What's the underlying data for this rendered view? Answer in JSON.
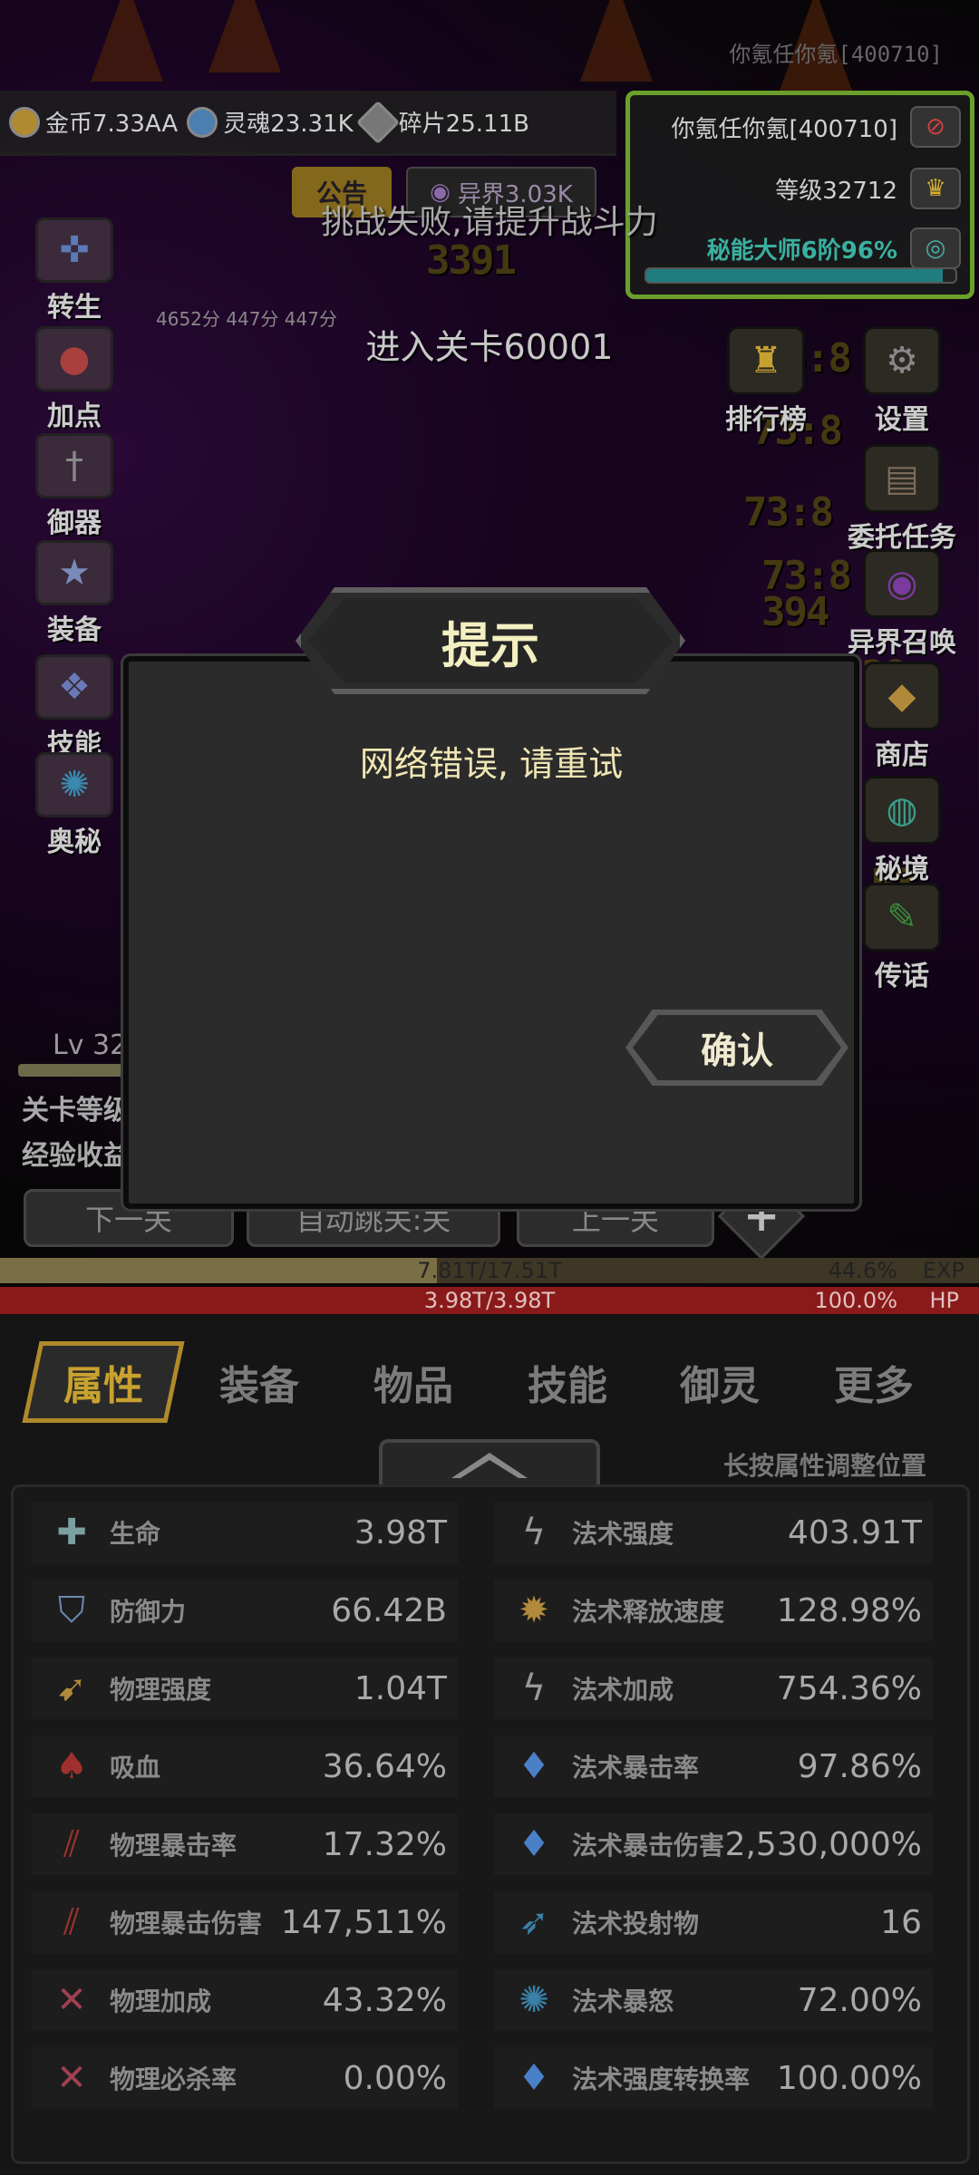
{
  "player_id_faint": "你氪任你氪[400710]",
  "currency": {
    "coin": "金币7.33AA",
    "soul": "灵魂23.31K",
    "shard": "碎片25.11B"
  },
  "player": {
    "name": "你氪任你氪[400710]",
    "level": "等级32712",
    "rank": "秘能大师6阶96%",
    "rank_progress": 0.96
  },
  "chips": {
    "notice": "公告",
    "realm": "异界3.03K"
  },
  "toasts": {
    "fail": "挑战失败,请提升战斗力",
    "enter": "进入关卡60001"
  },
  "scores": "4652分  447分  447分",
  "left_menu": [
    {
      "label": "转生",
      "icon": "rebirth-icon"
    },
    {
      "label": "加点",
      "icon": "meat-icon"
    },
    {
      "label": "御器",
      "icon": "sword-icon"
    },
    {
      "label": "装备",
      "icon": "star-shield-icon"
    },
    {
      "label": "技能",
      "icon": "scroll-icon"
    },
    {
      "label": "奥秘",
      "icon": "vortex-icon"
    }
  ],
  "right_menu": [
    {
      "label": "排行榜",
      "icon": "trophy-icon"
    },
    {
      "label": "设置",
      "icon": "gear-icon"
    },
    {
      "label": "委托任务",
      "icon": "book-icon"
    },
    {
      "label": "异界召唤",
      "icon": "portal-icon"
    },
    {
      "label": "商店",
      "icon": "shop-icon"
    },
    {
      "label": "秘境",
      "icon": "secret-realm-icon"
    },
    {
      "label": "传话",
      "icon": "message-icon"
    }
  ],
  "stage": {
    "level_label": "Lv 32",
    "info1": "关卡等级",
    "info2": "经验收益"
  },
  "nav": {
    "next": "下一关",
    "auto": "自动跳关:关",
    "prev": "上一关"
  },
  "bars": {
    "exp_value": "7.81T/17.51T",
    "exp_percent": "44.6%",
    "exp_label": "EXP",
    "exp_fraction": 0.446,
    "hp_value": "3.98T/3.98T",
    "hp_percent": "100.0%",
    "hp_label": "HP"
  },
  "modal": {
    "title": "提示",
    "message": "网络错误, 请重试",
    "confirm": "确认"
  },
  "tabs": [
    "属性",
    "装备",
    "物品",
    "技能",
    "御灵",
    "更多"
  ],
  "active_tab": "属性",
  "hint": "长按属性调整位置",
  "attributes_left": [
    {
      "name": "生命",
      "value": "3.98T",
      "icon": "health-cross-icon"
    },
    {
      "name": "防御力",
      "value": "66.42B",
      "icon": "shield-icon"
    },
    {
      "name": "物理强度",
      "value": "1.04T",
      "icon": "feather-blade-icon"
    },
    {
      "name": "吸血",
      "value": "36.64%",
      "icon": "bat-icon"
    },
    {
      "name": "物理暴击率",
      "value": "17.32%",
      "icon": "claw-icon"
    },
    {
      "name": "物理暴击伤害",
      "value": "147,511%",
      "icon": "claw-icon"
    },
    {
      "name": "物理加成",
      "value": "43.32%",
      "icon": "slash-icon"
    },
    {
      "name": "物理必杀率",
      "value": "0.00%",
      "icon": "slash-icon"
    }
  ],
  "attributes_right": [
    {
      "name": "法术强度",
      "value": "403.91T",
      "icon": "lightning-icon"
    },
    {
      "name": "法术释放速度",
      "value": "128.98%",
      "icon": "spark-icon"
    },
    {
      "name": "法术加成",
      "value": "754.36%",
      "icon": "lightning-icon"
    },
    {
      "name": "法术暴击率",
      "value": "97.86%",
      "icon": "blue-flame-icon"
    },
    {
      "name": "法术暴击伤害",
      "value": "2,530,000%",
      "icon": "blue-flame-icon"
    },
    {
      "name": "法术投射物",
      "value": "16",
      "icon": "projectile-icon"
    },
    {
      "name": "法术暴怒",
      "value": "72.00%",
      "icon": "rage-icon"
    },
    {
      "name": "法术强度转换率",
      "value": "100.00%",
      "icon": "blue-flame-icon"
    }
  ],
  "colors": {
    "accent_gold": "#c8a230",
    "rank_teal": "#3ab0a0",
    "panel_green": "#6aa02a",
    "hp_red": "#8a1a1a",
    "modal_text": "#f0e6b4"
  }
}
